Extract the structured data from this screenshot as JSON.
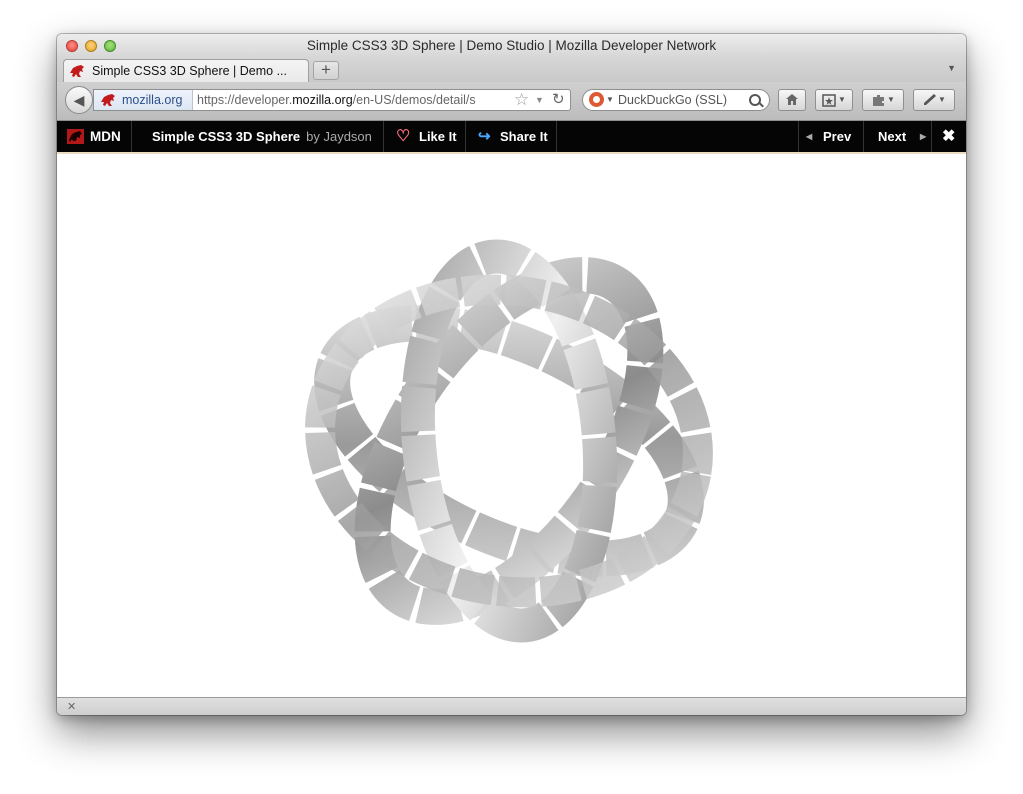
{
  "window": {
    "title": "Simple CSS3 3D Sphere | Demo Studio | Mozilla Developer Network"
  },
  "tabs": [
    {
      "title": "Simple CSS3 3D Sphere | Demo ...",
      "favicon": "mozilla-dino-icon"
    }
  ],
  "tabstrip": {
    "new_tab_symbol": "+",
    "list_all_symbol": "▼"
  },
  "navbar": {
    "identity": "mozilla.org",
    "url_prefix": "https://developer.",
    "url_host": "mozilla.org",
    "url_path": "/en-US/demos/detail/s",
    "search_engine": "DuckDuckGo (SSL)"
  },
  "mdn_bar": {
    "logo": "MDN",
    "demo_title": "Simple CSS3 3D Sphere",
    "demo_author": "by Jaydson",
    "like": "Like It",
    "share": "Share It",
    "prev": "Prev",
    "next": "Next",
    "close": "✖"
  },
  "addon_bar": {
    "close": "✕"
  },
  "colors": {
    "mdn_bar_bg": "#050505",
    "heart": "#ff6d7e",
    "share": "#4aa7ff",
    "ring_light": "#e6e6e6",
    "ring_dark": "#8a8a8a"
  }
}
